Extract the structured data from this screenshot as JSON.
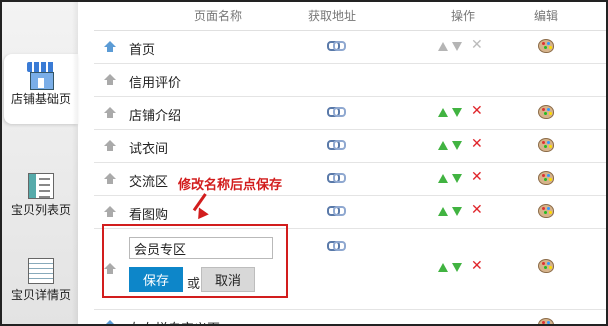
{
  "header": {
    "name_col": "页面名称",
    "url_col": "获取地址",
    "ops_col": "操作",
    "edit_col": "编辑"
  },
  "sidebar": [
    {
      "label": "店铺基础页",
      "icon": "shop-icon",
      "active": true
    },
    {
      "label": "宝贝列表页",
      "icon": "list-page-icon",
      "active": false
    },
    {
      "label": "宝贝详情页",
      "icon": "detail-page-icon",
      "active": false
    }
  ],
  "rows": [
    {
      "name": "首页",
      "home_icon": "blue",
      "link": true,
      "ops": "disabled",
      "edit": true
    },
    {
      "name": "信用评价",
      "home_icon": "gray",
      "link": false,
      "ops": "none",
      "edit": false
    },
    {
      "name": "店铺介绍",
      "home_icon": "gray",
      "link": true,
      "ops": "enabled",
      "edit": true
    },
    {
      "name": "试衣间",
      "home_icon": "gray",
      "link": true,
      "ops": "enabled",
      "edit": true
    },
    {
      "name": "交流区",
      "home_icon": "gray",
      "link": true,
      "ops": "enabled",
      "edit": true
    },
    {
      "name": "看图购",
      "home_icon": "gray",
      "link": true,
      "ops": "enabled",
      "edit": true
    }
  ],
  "edit_row": {
    "value": "会员专区",
    "save_label": "保存",
    "or_label": "或",
    "cancel_label": "取消"
  },
  "last_row": {
    "name": "左右栏自定义页"
  },
  "annotation": {
    "text": "修改名称后点保存"
  },
  "colors": {
    "accent": "#0d86c9",
    "annotation": "#d21d1d",
    "arrow_green": "#41b341",
    "delete_red": "#e0252b"
  }
}
